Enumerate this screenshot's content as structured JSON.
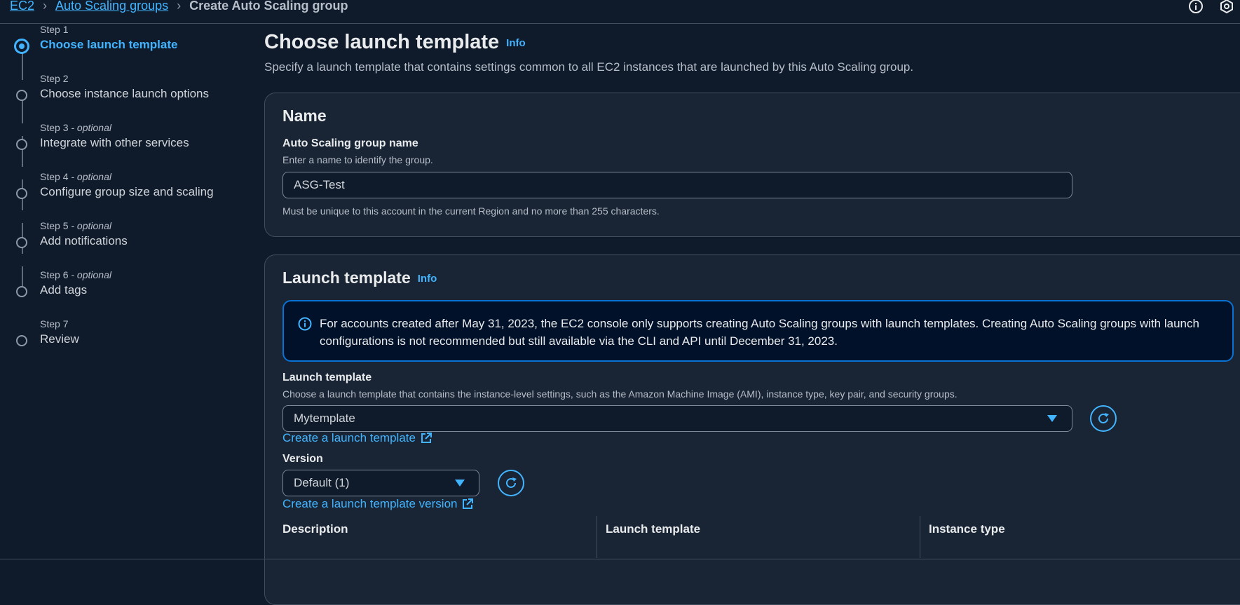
{
  "breadcrumbs": {
    "ec2": "EC2",
    "asg": "Auto Scaling groups",
    "current": "Create Auto Scaling group"
  },
  "top_icons": [
    "info-circle-icon",
    "settings-icon"
  ],
  "steps": [
    {
      "meta": "Step 1",
      "optional": "",
      "label": "Choose launch template",
      "active": true
    },
    {
      "meta": "Step 2",
      "optional": "",
      "label": "Choose instance launch options",
      "active": false
    },
    {
      "meta": "Step 3",
      "optional": " - optional",
      "label": "Integrate with other services",
      "active": false
    },
    {
      "meta": "Step 4",
      "optional": " - optional",
      "label": "Configure group size and scaling",
      "active": false
    },
    {
      "meta": "Step 5",
      "optional": " - optional",
      "label": "Add notifications",
      "active": false
    },
    {
      "meta": "Step 6",
      "optional": " - optional",
      "label": "Add tags",
      "active": false
    },
    {
      "meta": "Step 7",
      "optional": "",
      "label": "Review",
      "active": false
    }
  ],
  "page": {
    "title": "Choose launch template",
    "info": "Info",
    "description": "Specify a launch template that contains settings common to all EC2 instances that are launched by this Auto Scaling group."
  },
  "name_card": {
    "title": "Name",
    "label": "Auto Scaling group name",
    "hint": "Enter a name to identify the group.",
    "value": "ASG-Test",
    "constraint": "Must be unique to this account in the current Region and no more than 255 characters."
  },
  "launch_card": {
    "title": "Launch template",
    "info": "Info",
    "alert": "For accounts created after May 31, 2023, the EC2 console only supports creating Auto Scaling groups with launch templates. Creating Auto Scaling groups with launch configurations is not recommended but still available via the CLI and API until December 31, 2023.",
    "template_label": "Launch template",
    "template_hint": "Choose a launch template that contains the instance-level settings, such as the Amazon Machine Image (AMI), instance type, key pair, and security groups.",
    "template_value": "Mytemplate",
    "create_template_link": "Create a launch template",
    "version_label": "Version",
    "version_value": "Default (1)",
    "create_version_link": "Create a launch template version",
    "columns": [
      "Description",
      "Launch template",
      "Instance type"
    ]
  },
  "colors": {
    "background": "#0f1b2a",
    "card": "#192534",
    "accent": "#42b4ff",
    "alert_border": "#0972d3"
  }
}
